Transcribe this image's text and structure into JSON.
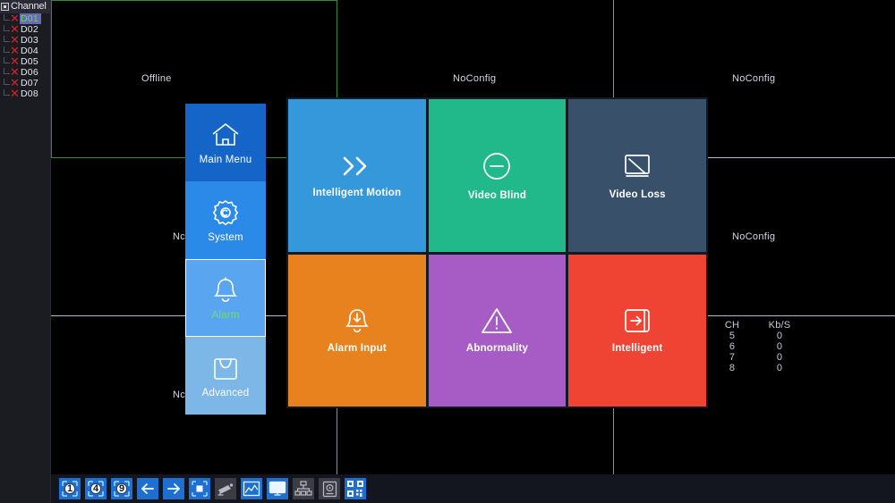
{
  "sidebar": {
    "header": "Channel",
    "header_icon": "checkbox-icon",
    "channels": [
      {
        "name": "D01",
        "status_icon": "x-mark-icon",
        "selected": true
      },
      {
        "name": "D02",
        "status_icon": "x-mark-icon",
        "selected": false
      },
      {
        "name": "D03",
        "status_icon": "x-mark-icon",
        "selected": false
      },
      {
        "name": "D04",
        "status_icon": "x-mark-icon",
        "selected": false
      },
      {
        "name": "D05",
        "status_icon": "x-mark-icon",
        "selected": false
      },
      {
        "name": "D06",
        "status_icon": "x-mark-icon",
        "selected": false
      },
      {
        "name": "D07",
        "status_icon": "x-mark-icon",
        "selected": false
      },
      {
        "name": "D08",
        "status_icon": "x-mark-icon",
        "selected": false
      }
    ]
  },
  "grid": {
    "cells": [
      {
        "label": "Offline"
      },
      {
        "label": "NoConfig"
      },
      {
        "label": "NoConfig"
      },
      {
        "label": "Nc"
      },
      {
        "label": "NoConfig"
      },
      {
        "label": "Nc"
      }
    ],
    "selection_color": "#2f8f2f"
  },
  "bitrate": {
    "columns": [
      "CH",
      "Kb/S"
    ],
    "rows": [
      {
        "ch": "5",
        "kbs": "0"
      },
      {
        "ch": "6",
        "kbs": "0"
      },
      {
        "ch": "7",
        "kbs": "0"
      },
      {
        "ch": "8",
        "kbs": "0"
      }
    ]
  },
  "menu": {
    "items": [
      {
        "label": "Main Menu",
        "icon": "home-icon",
        "color": "#1565c8",
        "active": false
      },
      {
        "label": "System",
        "icon": "gear-icon",
        "color": "#2b8ae8",
        "active": false
      },
      {
        "label": "Alarm",
        "icon": "bell-icon",
        "color": "#5aa5ef",
        "active": true
      },
      {
        "label": "Advanced",
        "icon": "toolbox-icon",
        "color": "#7cb7e8",
        "active": false
      }
    ]
  },
  "tiles": [
    {
      "label": "Intelligent Motion",
      "icon": "double-chevron-icon",
      "color": "#3498db"
    },
    {
      "label": "Video Blind",
      "icon": "circle-minus-icon",
      "color": "#21b98a"
    },
    {
      "label": "Video Loss",
      "icon": "monitor-slash-icon",
      "color": "#39506b"
    },
    {
      "label": "Alarm Input",
      "icon": "bell-download-icon",
      "color": "#e8821e"
    },
    {
      "label": "Abnormality",
      "icon": "warning-triangle-icon",
      "color": "#a65cc4"
    },
    {
      "label": "Intelligent",
      "icon": "arrow-in-box-icon",
      "color": "#ef4434"
    }
  ],
  "toolbar": {
    "buttons": [
      {
        "name": "layout-1-button",
        "icon": "layout-1-icon",
        "label": "1",
        "enabled": true
      },
      {
        "name": "layout-4-button",
        "icon": "layout-4-icon",
        "label": "4",
        "enabled": true
      },
      {
        "name": "layout-9-button",
        "icon": "layout-9-icon",
        "label": "9",
        "enabled": true
      },
      {
        "name": "previous-button",
        "icon": "arrow-left-icon",
        "label": "",
        "enabled": true
      },
      {
        "name": "next-button",
        "icon": "arrow-right-icon",
        "label": "",
        "enabled": true
      },
      {
        "name": "stop-button",
        "icon": "stop-square-icon",
        "label": "",
        "enabled": true
      },
      {
        "name": "ptz-camera-button",
        "icon": "camera-icon",
        "label": "",
        "enabled": false
      },
      {
        "name": "color-setting-button",
        "icon": "chart-icon",
        "label": "",
        "enabled": true
      },
      {
        "name": "output-adjust-button",
        "icon": "monitor-icon",
        "label": "",
        "enabled": true
      },
      {
        "name": "network-button",
        "icon": "network-tree-icon",
        "label": "",
        "enabled": false
      },
      {
        "name": "hdd-info-button",
        "icon": "hdd-icon",
        "label": "",
        "enabled": false
      },
      {
        "name": "qr-code-button",
        "icon": "qr-code-icon",
        "label": "",
        "enabled": true
      }
    ]
  }
}
